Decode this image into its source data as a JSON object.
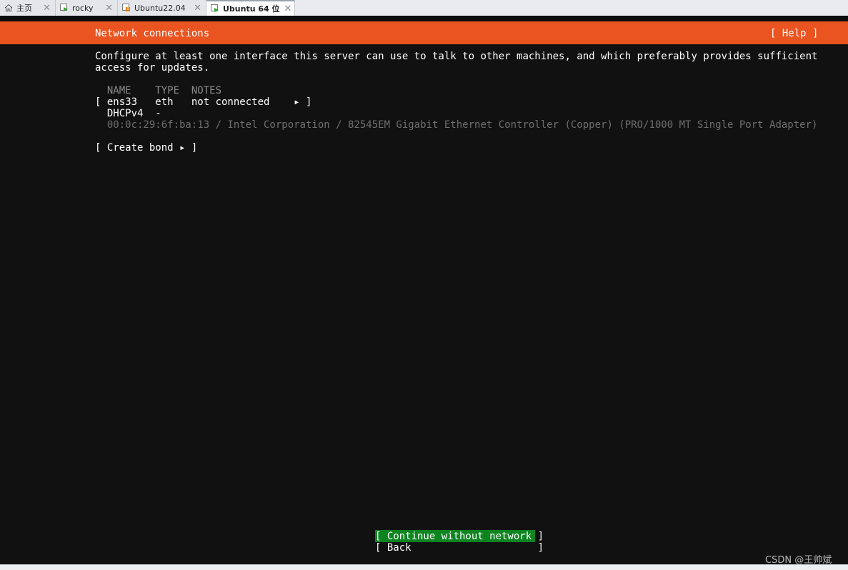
{
  "tabs": [
    {
      "label": "主页",
      "icon": "home-icon"
    },
    {
      "label": "rocky",
      "icon": "vm-running-icon"
    },
    {
      "label": "Ubuntu22.04",
      "icon": "vm-paused-icon"
    },
    {
      "label": "Ubuntu 64 位",
      "icon": "vm-running-icon",
      "active": true
    }
  ],
  "tab_close_glyph": "✕",
  "installer": {
    "title": "Network connections",
    "help": "[ Help ]",
    "description_line1": "Configure at least one interface this server can use to talk to other machines, and which preferably provides sufficient",
    "description_line2": "access for updates.",
    "columns": "  NAME    TYPE  NOTES",
    "interface_row": "[ ens33   eth   not connected    ▸ ]",
    "dhcp_row": "  DHCPv4  -",
    "hardware_row": "  00:0c:29:6f:ba:13 / Intel Corporation / 82545EM Gigabit Ethernet Controller (Copper) (PRO/1000 MT Single Port Adapter)",
    "create_bond": "[ Create bond ▸ ]",
    "continue_button": "[ Continue without network ]",
    "back_button": "[ Back                     ]"
  },
  "watermark": "CSDN @王帅斌",
  "colors": {
    "accent_orange": "#e95420",
    "button_green": "#0e8420",
    "background": "#111111"
  }
}
